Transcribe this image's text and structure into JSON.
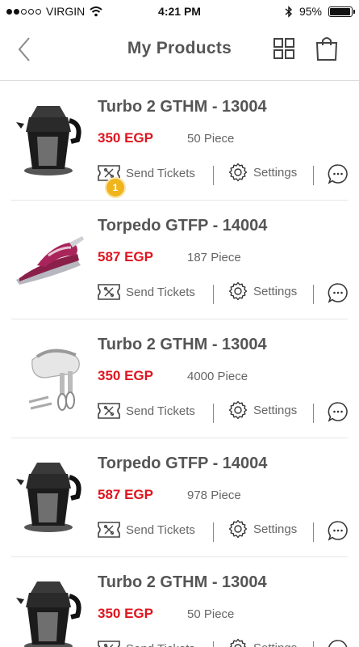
{
  "status_bar": {
    "carrier": "VIRGIN",
    "time": "4:21 PM",
    "battery_text": "95%",
    "battery_level": 0.95,
    "signal_bars": 2
  },
  "nav": {
    "title": "My Products",
    "icons": {
      "back": "chevron-left-icon",
      "grid": "grid-icon",
      "cart": "shopping-bag-icon"
    }
  },
  "actions": {
    "send_tickets_label": "Send Tickets",
    "settings_label": "Settings"
  },
  "colors": {
    "price": "#e0141e",
    "badge": "#f0b51d",
    "text": "#555555"
  },
  "products": [
    {
      "name": "Turbo 2 GTHM - 13004",
      "price": "350 EGP",
      "quantity": "50 Piece",
      "image": "citrus-juicer",
      "badge": "1"
    },
    {
      "name": "Torpedo GTFP - 14004",
      "price": "587 EGP",
      "quantity": "187 Piece",
      "image": "steam-iron"
    },
    {
      "name": "Turbo 2 GTHM - 13004",
      "price": "350 EGP",
      "quantity": "4000 Piece",
      "image": "hand-mixer"
    },
    {
      "name": "Torpedo GTFP - 14004",
      "price": "587 EGP",
      "quantity": "978 Piece",
      "image": "citrus-juicer"
    },
    {
      "name": "Turbo 2 GTHM - 13004",
      "price": "350 EGP",
      "quantity": "50 Piece",
      "image": "citrus-juicer"
    }
  ]
}
